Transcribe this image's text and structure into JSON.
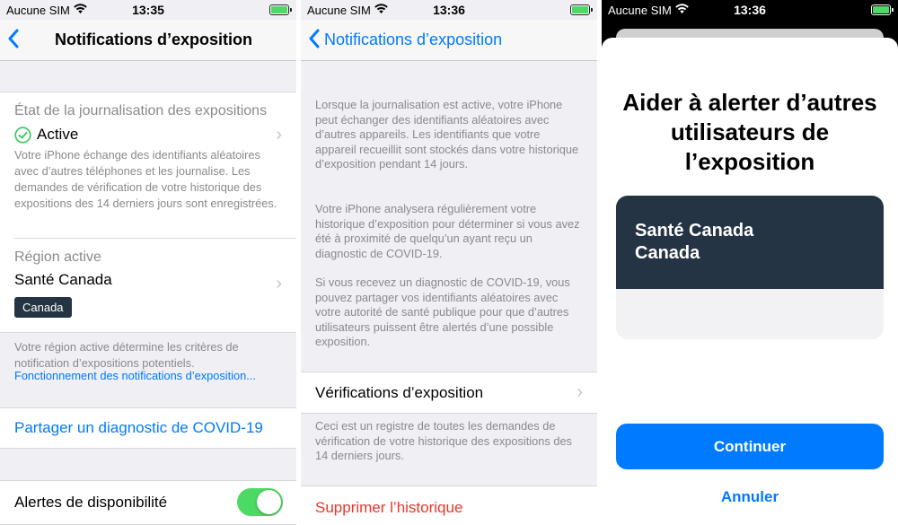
{
  "status": {
    "carrier": "Aucune SIM",
    "time1": "13:35",
    "time2": "13:36",
    "time3": "13:36"
  },
  "screen1": {
    "nav_title": "Notifications d’exposition",
    "logging_label": "État de la journalisation des expositions",
    "logging_status": "Active",
    "logging_desc": "Votre iPhone échange des identifiants aléatoires avec d’autres téléphones et les journalise. Les demandes de vérification de votre historique des expositions des 14 derniers jours sont enregistrées.",
    "region_label": "Région active",
    "region_name": "Santé Canada",
    "region_badge": "Canada",
    "region_desc": "Votre région active détermine les critères de notification d’expositions potentiels.",
    "region_link": "Fonctionnement des notifications d’exposition...",
    "share_label": "Partager un diagnostic de COVID-19",
    "availability_label": "Alertes de disponibilité"
  },
  "screen2": {
    "nav_title": "Notifications d’exposition",
    "para1": "Lorsque la journalisation est active, votre iPhone peut échanger des identifiants aléatoires avec d’autres appareils. Les identifiants que votre appareil recueillit sont stockés dans votre historique d’exposition pendant 14 jours.",
    "para2": "Votre iPhone analysera régulièrement votre historique d’exposition pour déterminer si vous avez été à proximité de quelqu’un ayant reçu un diagnostic de COVID-19.",
    "para3": "Si vous recevez un diagnostic de COVID-19, vous pouvez partager vos identifiants aléatoires avec votre autorité de santé publique pour que d’autres utilisateurs puissent être alertés d’une possible exposition.",
    "checks_label": "Vérifications d’exposition",
    "checks_desc": "Ceci est un registre de toutes les demandes de vérification de votre historique des expositions des 14 derniers jours.",
    "delete_label": "Supprimer l’historique"
  },
  "screen3": {
    "title": "Aider à alerter d’autres utilisateurs de l’exposition",
    "card_line1": "Santé Canada",
    "card_line2": "Canada",
    "continue_label": "Continuer",
    "cancel_label": "Annuler"
  },
  "colors": {
    "ios_blue": "#007aff",
    "toggle_green": "#4cd964",
    "delete_red": "#e8362c",
    "card_dark": "#253444"
  }
}
